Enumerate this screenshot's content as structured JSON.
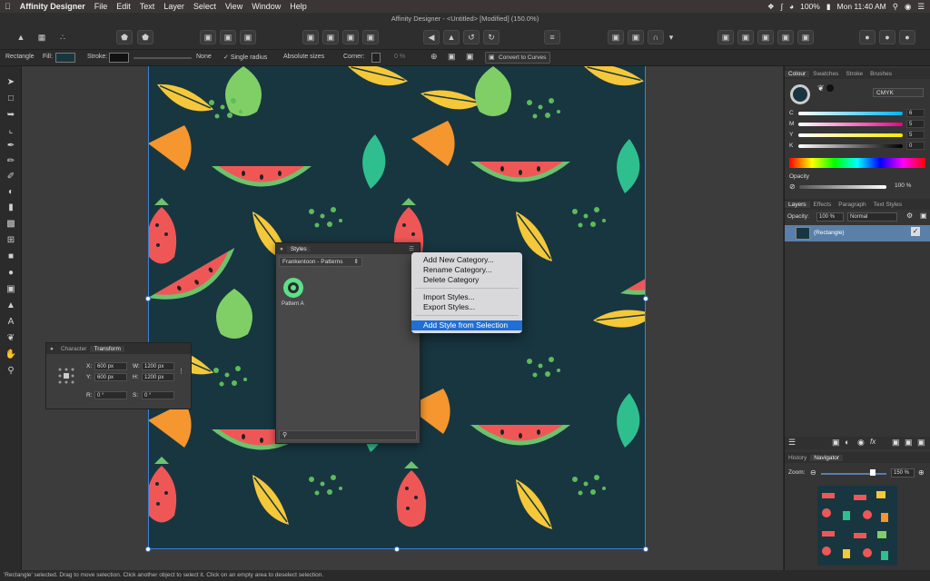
{
  "menubar": {
    "apple_icon": "apple-icon",
    "app_name": "Affinity Designer",
    "items": [
      "File",
      "Edit",
      "Text",
      "Layer",
      "Select",
      "View",
      "Window",
      "Help"
    ],
    "battery": "100%",
    "clock": "Mon 11:40 AM"
  },
  "window": {
    "title": "Affinity Designer - <Untitled> [Modified] (150.0%)"
  },
  "context_toolbar": {
    "tool_name": "Rectangle",
    "fill_label": "Fill:",
    "stroke_label": "Stroke:",
    "stroke_value": "None",
    "single_radius": "Single radius",
    "absolute_sizes": "Absolute sizes",
    "corner_label": "Corner:",
    "corner_value": "0 %",
    "convert_button": "Convert to Curves"
  },
  "colors": {
    "canvas_bg": "#183640",
    "accent": "#3d7fd6",
    "layer_selected": "#5a7fa8",
    "menu_highlight": "#1f6fd6"
  },
  "styles_panel": {
    "title": "Styles",
    "category": "Frankentoon - Patterns",
    "items": [
      {
        "label": "Pattern A"
      }
    ]
  },
  "context_menu": {
    "items": [
      {
        "label": "Add New Category..."
      },
      {
        "label": "Rename Category..."
      },
      {
        "label": "Delete Category"
      },
      {
        "label": "Import Styles..."
      },
      {
        "label": "Export Styles..."
      },
      {
        "label": "Add Style from Selection",
        "highlighted": true
      }
    ]
  },
  "transform_panel": {
    "tabs": [
      "Character",
      "Transform"
    ],
    "active_tab": "Transform",
    "x_label": "X:",
    "x": "600 px",
    "y_label": "Y:",
    "y": "600 px",
    "w_label": "W:",
    "w": "1200 px",
    "h_label": "H:",
    "h": "1200 px",
    "r_label": "R:",
    "r": "0 °",
    "s_label": "S:",
    "s": "0 °"
  },
  "colour_panel": {
    "tabs": [
      "Colour",
      "Swatches",
      "Stroke",
      "Brushes"
    ],
    "model": "CMYK",
    "channels": [
      {
        "label": "C",
        "value": "6"
      },
      {
        "label": "M",
        "value": "5"
      },
      {
        "label": "Y",
        "value": "5"
      },
      {
        "label": "K",
        "value": "0"
      }
    ],
    "opacity_label": "Opacity",
    "opacity_value": "100 %"
  },
  "layers_panel": {
    "tabs": [
      "Layers",
      "Effects",
      "Paragraph",
      "Text Styles"
    ],
    "opacity_label": "Opacity:",
    "opacity_value": "100 %",
    "blend_mode": "Normal",
    "layer_name": "(Rectangle)",
    "fx_label": "fx"
  },
  "navigator_panel": {
    "tabs": [
      "History",
      "Navigator"
    ],
    "zoom_label": "Zoom:",
    "zoom_value": "150 %"
  },
  "status": {
    "text": "'Rectangle' selected. Drag to move selection. Click another object to select it. Click on an empty area to deselect selection."
  }
}
